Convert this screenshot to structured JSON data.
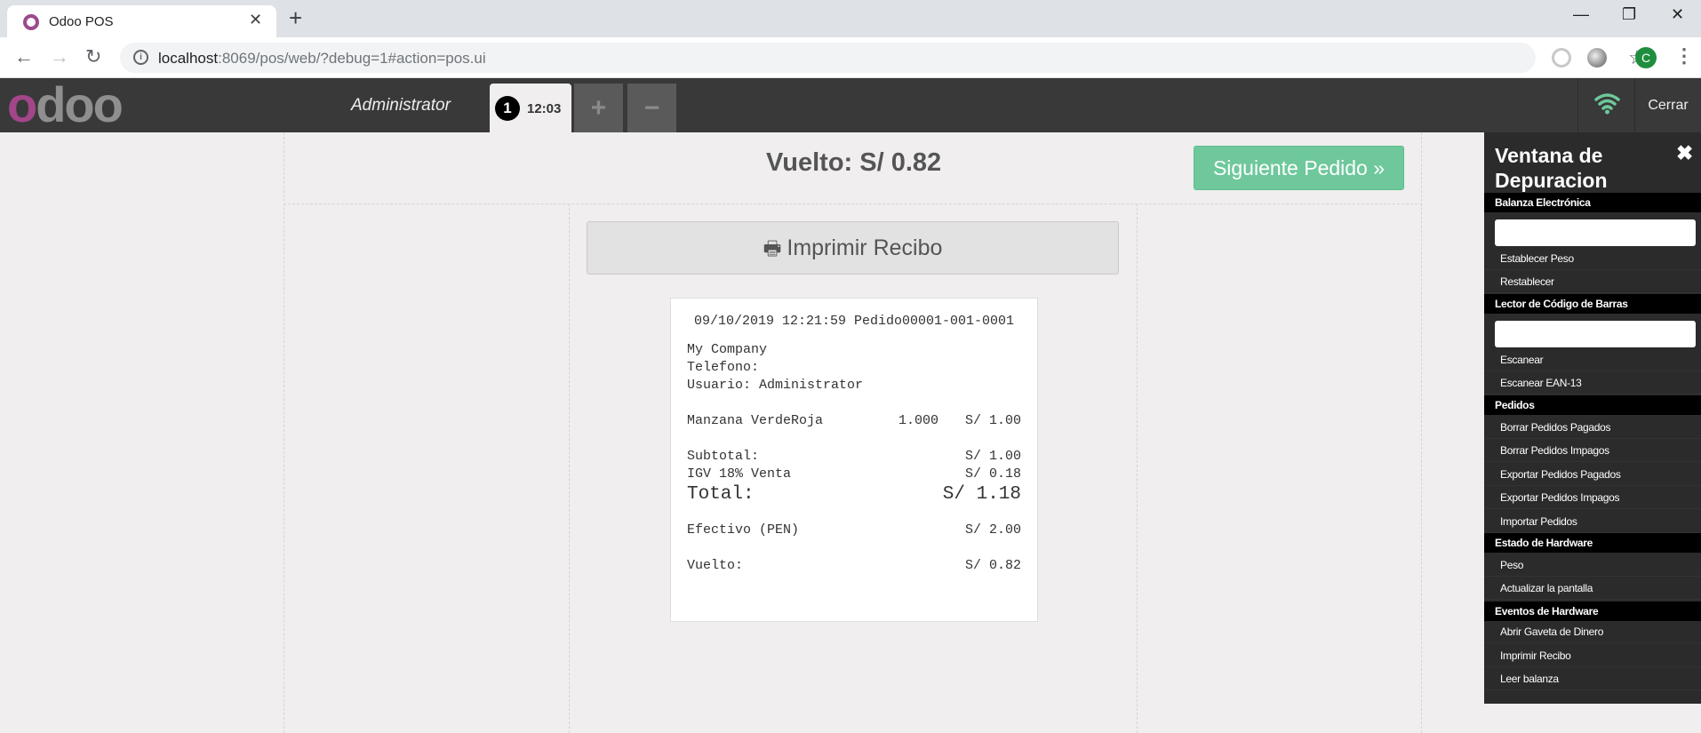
{
  "browser": {
    "tab_title": "Odoo POS",
    "url_host": "localhost",
    "url_rest": ":8069/pos/web/?debug=1#action=pos.ui",
    "profile_initial": "C"
  },
  "pos": {
    "logo": "odoo",
    "user": "Administrator",
    "order_number": "1",
    "order_time": "12:03",
    "add_order": "+",
    "remove_order": "−",
    "close": "Cerrar"
  },
  "receipt_screen": {
    "change_title": "Vuelto: S/ 0.82",
    "next_order": "Siguiente Pedido »",
    "print_receipt": "Imprimir Recibo"
  },
  "receipt": {
    "header": "09/10/2019 12:21:59 Pedido00001-001-0001",
    "company": "My Company",
    "phone": "Telefono:",
    "user": "Usuario: Administrator",
    "line_product": "Manzana VerdeRoja",
    "line_qty": "1.000",
    "line_price": "S/ 1.00",
    "subtotal_label": "Subtotal:",
    "subtotal_value": "S/ 1.00",
    "tax_label": "IGV 18% Venta",
    "tax_value": "S/ 0.18",
    "total_label": "Total:",
    "total_value": "S/ 1.18",
    "payment_label": "Efectivo (PEN)",
    "payment_value": "S/ 2.00",
    "change_label": "Vuelto:",
    "change_value": "S/ 0.82"
  },
  "debug": {
    "title": "Ventana de Depuracion",
    "close": "✖",
    "scale_section": "Balanza Electrónica",
    "set_weight": "Establecer Peso",
    "reset": "Restablecer",
    "barcode_section": "Lector de Código de Barras",
    "scan": "Escanear",
    "scan_ean": "Escanear EAN-13",
    "orders_section": "Pedidos",
    "delete_paid": "Borrar Pedidos Pagados",
    "delete_unpaid": "Borrar Pedidos Impagos",
    "export_paid": "Exportar Pedidos Pagados",
    "export_unpaid": "Exportar Pedidos Impagos",
    "import_orders": "Importar Pedidos",
    "hw_status_section": "Estado de Hardware",
    "weight": "Peso",
    "refresh_screen": "Actualizar la pantalla",
    "hw_events_section": "Eventos de Hardware",
    "open_cashbox": "Abrir Gaveta de Dinero",
    "print_receipt": "Imprimir Recibo",
    "read_scale": "Leer balanza"
  },
  "colors": {
    "odoo_purple": "#a24689",
    "next_green": "#6ec89b",
    "wifi_green": "#6ec89b"
  }
}
